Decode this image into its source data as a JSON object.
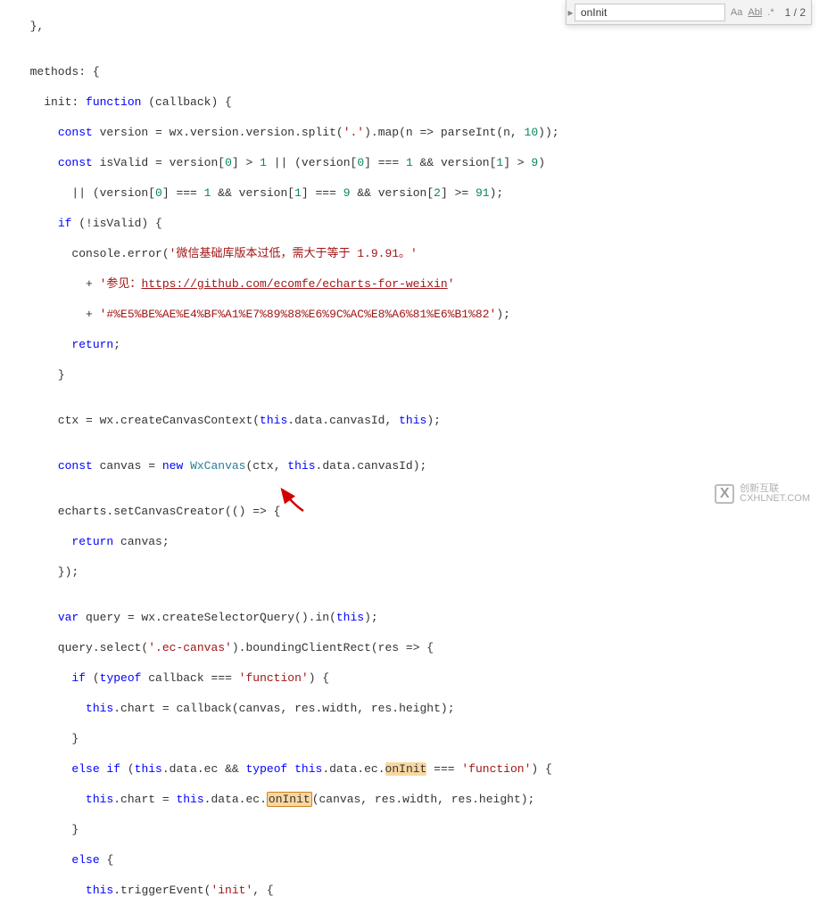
{
  "search": {
    "value": "onInit",
    "result": "1 / 2",
    "case_icon": "Aa",
    "whole_icon": "Abl",
    "regex_icon": ".*"
  },
  "code": {
    "l01": "  },",
    "l02": "",
    "l03": "  methods: {",
    "l04a": "    init: ",
    "l04b": "function",
    "l04c": " (callback) {",
    "l05a": "      ",
    "l05b": "const",
    "l05c": " version = wx.version.version.split(",
    "l05d": "'.'",
    "l05e": ").map(n => parseInt(n, ",
    "l05f": "10",
    "l05g": "));",
    "l06a": "      ",
    "l06b": "const",
    "l06c": " isValid = version[",
    "l06d": "0",
    "l06e": "] > ",
    "l06f": "1",
    "l06g": " || (version[",
    "l06h": "0",
    "l06i": "] === ",
    "l06j": "1",
    "l06k": " && version[",
    "l06l": "1",
    "l06m": "] > ",
    "l06n": "9",
    "l06o": ")",
    "l07a": "        || (version[",
    "l07b": "0",
    "l07c": "] === ",
    "l07d": "1",
    "l07e": " && version[",
    "l07f": "1",
    "l07g": "] === ",
    "l07h": "9",
    "l07i": " && version[",
    "l07j": "2",
    "l07k": "] >= ",
    "l07l": "91",
    "l07m": ");",
    "l08a": "      ",
    "l08b": "if",
    "l08c": " (!isValid) {",
    "l09a": "        console.error(",
    "l09b": "'微信基础库版本过低，需大于等于 1.9.91。'",
    "l10a": "          + ",
    "l10b": "'参见：",
    "l10c": "https://github.com/ecomfe/echarts-for-weixin",
    "l10d": "'",
    "l11a": "          + ",
    "l11b": "'#%E5%BE%AE%E4%BF%A1%E7%89%88%E6%9C%AC%E8%A6%81%E6%B1%82'",
    "l11c": ");",
    "l12a": "        ",
    "l12b": "return",
    "l12c": ";",
    "l13": "      }",
    "l14": "",
    "l15a": "      ctx = wx.createCanvasContext(",
    "l15b": "this",
    "l15c": ".data.canvasId, ",
    "l15d": "this",
    "l15e": ");",
    "l16": "",
    "l17a": "      ",
    "l17b": "const",
    "l17c": " canvas = ",
    "l17d": "new",
    "l17e": " ",
    "l17f": "WxCanvas",
    "l17g": "(ctx, ",
    "l17h": "this",
    "l17i": ".data.canvasId);",
    "l18": "",
    "l19a": "      echarts.setCanvasCreator(() => {",
    "l20a": "        ",
    "l20b": "return",
    "l20c": " canvas;",
    "l21": "      });",
    "l22": "",
    "l23a": "      ",
    "l23b": "var",
    "l23c": " query = wx.createSelectorQuery().in(",
    "l23d": "this",
    "l23e": ");",
    "l24a": "      query.select(",
    "l24b": "'.ec-canvas'",
    "l24c": ").boundingClientRect(res => {",
    "l25a": "        ",
    "l25b": "if",
    "l25c": " (",
    "l25d": "typeof",
    "l25e": " callback === ",
    "l25f": "'function'",
    "l25g": ") {",
    "l26a": "          ",
    "l26b": "this",
    "l26c": ".chart = callback(canvas, res.width, res.height);",
    "l27": "        }",
    "l28a": "        ",
    "l28b": "else if",
    "l28c": " (",
    "l28d": "this",
    "l28e": ".data.ec && ",
    "l28f": "typeof",
    "l28g": " ",
    "l28h": "this",
    "l28i": ".data.ec.",
    "l28j": "onInit",
    "l28k": " === ",
    "l28l": "'function'",
    "l28m": ") {",
    "l29a": "          ",
    "l29b": "this",
    "l29c": ".chart = ",
    "l29d": "this",
    "l29e": ".data.ec.",
    "l29f": "onInit",
    "l29g": "(canvas, res.width, res.height);",
    "l30": "        }",
    "l31a": "        ",
    "l31b": "else",
    "l31c": " {",
    "l32a": "          ",
    "l32b": "this",
    "l32c": ".triggerEvent(",
    "l32d": "'init'",
    "l32e": ", {"
  },
  "watermark": {
    "name": "创新互联",
    "sub": "CXHLNET.COM"
  }
}
